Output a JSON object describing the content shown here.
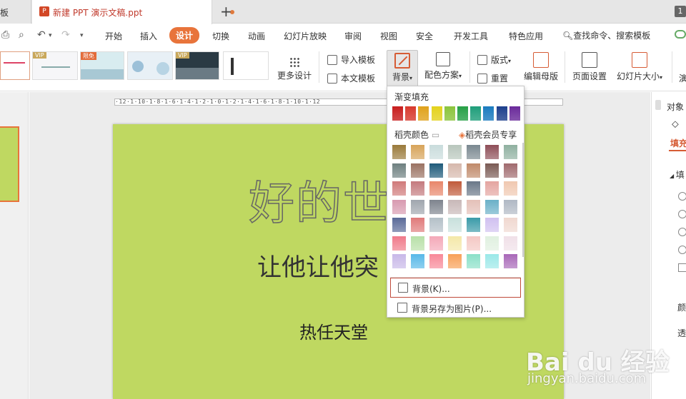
{
  "tabs": {
    "prev_tab": "板",
    "active_title": "新建 PPT 演示文稿.ppt",
    "new_tab": "+",
    "badge": "1"
  },
  "menu": {
    "items": [
      "开始",
      "插入",
      "设计",
      "切换",
      "动画",
      "幻灯片放映",
      "审阅",
      "视图",
      "安全",
      "开发工具",
      "特色应用"
    ],
    "active": "设计",
    "search": "查找命令、搜索模板"
  },
  "ribbon": {
    "thumb_tags": [
      "VIP",
      "限免",
      "VIP"
    ],
    "more_design": "更多设计",
    "import_template": "导入模板",
    "text_template": "本文模板",
    "background": "背景",
    "color_scheme": "配色方案",
    "layout": "版式",
    "reset": "重置",
    "edit_master": "编辑母版",
    "page_setup": "页面设置",
    "slide_size": "幻灯片大小",
    "cut_label": "演"
  },
  "ruler": {
    "text": "·12·1·10·1·8·1·6·1·4·1·2·1·0·1·2·1·4·1·6·1·8·1·10·1·12"
  },
  "slide": {
    "title": "好的世",
    "subtitle": "让他让他突",
    "subtitle2": "热任天堂"
  },
  "dropdown": {
    "gradient_heading": "渐变填充",
    "daoke_heading": "稻壳颜色",
    "member_label": "稻壳会员专享",
    "bg_item": "背景(K)...",
    "save_bg_item": "背景另存为图片(P)...",
    "gradient_row": [
      "#c81e1e",
      "#d83a2e",
      "#e0a21c",
      "#e4d21c",
      "#8bc43c",
      "#27a046",
      "#1f9e7a",
      "#1b7bbf",
      "#1d3f8c",
      "#6a2a9a"
    ],
    "swatch_rows": [
      [
        "#9a7a3a",
        "#d7a45a",
        "#c9dcdc",
        "#b8c6bc",
        "#7a8890",
        "#8e4e58",
        "#8fb0a0"
      ],
      [
        "#6e8080",
        "#9a7262",
        "#1e5a7a",
        "#d6b8ac",
        "#c08a6a",
        "#7a5a54",
        "#a06a6e"
      ],
      [
        "#d07a7a",
        "#c47a7e",
        "#e8866a",
        "#c05a3a",
        "#6a7888",
        "#e4a4a0",
        "#f0c8b0"
      ],
      [
        "#d89ab0",
        "#a0a6ae",
        "#7e848e",
        "#c8b8b8",
        "#e4c0b8",
        "#6ab0c8",
        "#b0b8c4"
      ],
      [
        "#5a6a98",
        "#e07a7a",
        "#b4c0c8",
        "#c8e0dc",
        "#3a9aa8",
        "#d0c0f0",
        "#f0d8d0"
      ],
      [
        "#f07a8a",
        "#b8e0a8",
        "#f4a8b8",
        "#f4e8a8",
        "#f4c8c4",
        "#e0f0e0",
        "#f0e0e8"
      ],
      [
        "#c8b8e8",
        "#58b8e8",
        "#f88898",
        "#f8a058",
        "#8ae0c8",
        "#9ae8e8",
        "#a868b8"
      ]
    ]
  },
  "right_panel": {
    "object_label": "对象",
    "fill_tab": "填充",
    "fill_section": "填",
    "color_label": "颜",
    "transparency_label": "透"
  },
  "watermark": {
    "main": "Bai du 经验",
    "sub": "jingyan.baidu.com"
  }
}
